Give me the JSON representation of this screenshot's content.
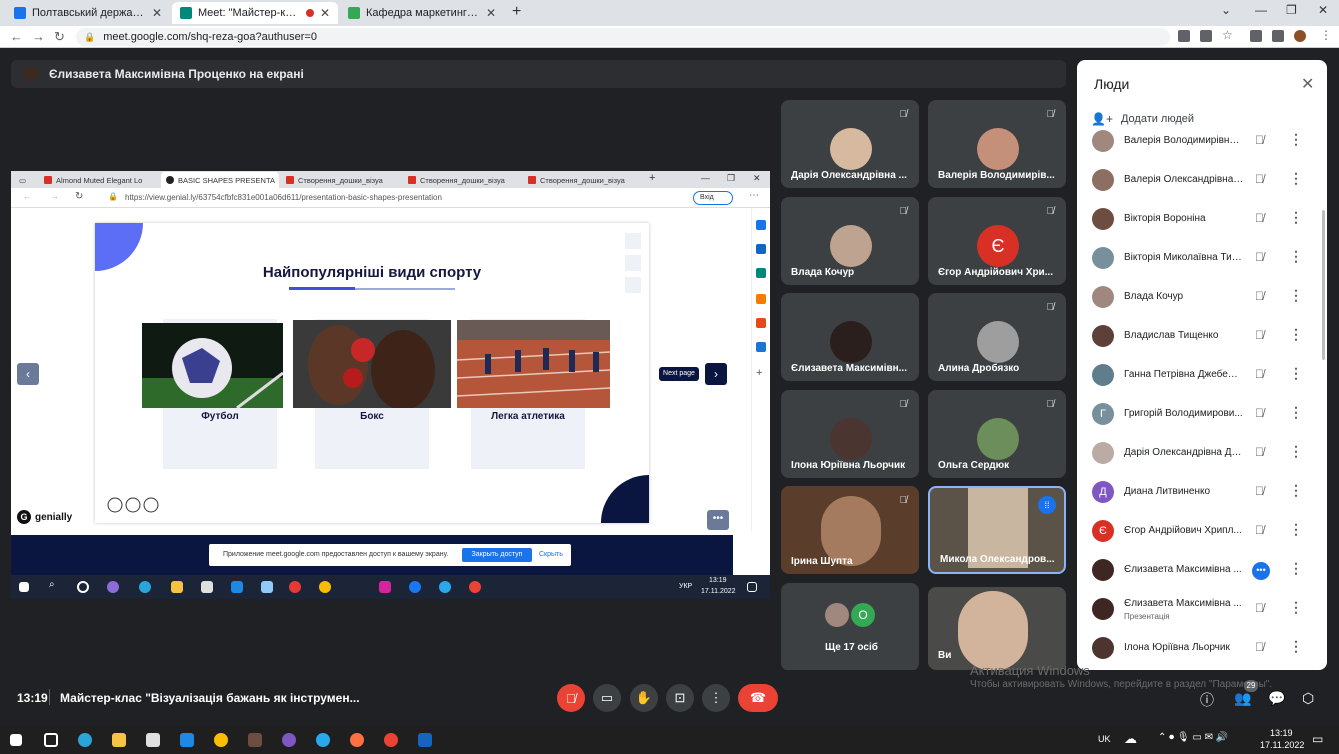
{
  "browser": {
    "tabs": [
      {
        "title": "Полтавський державний аграр",
        "color": "#1a73e8"
      },
      {
        "title": "Meet: \"Майстер-клас \"Візуа",
        "color": "#00897b"
      },
      {
        "title": "Кафедра маркетингу | Полтавс",
        "color": "#34a853"
      }
    ],
    "url": "meet.google.com/shq-reza-goa?authuser=0"
  },
  "presenter_bar": {
    "text": "Єлизавета Максимівна Проценко на екрані"
  },
  "shared_screen": {
    "tabs": [
      "Almond Muted Elegant Lo",
      "BASIC SHAPES PRESENTA",
      "Створення_дошки_візуа",
      "Створення_дошки_візуа",
      "Створення_дошки_візуа"
    ],
    "url": "https://view.genial.ly/63754cfbfc831e001a06d611/presentation-basic-shapes-presentation",
    "login_label": "Вхід",
    "slide": {
      "title": "Найпопулярніші  види спорту",
      "cards": [
        {
          "label": "Футбол"
        },
        {
          "label": "Бокс"
        },
        {
          "label": "Легка атлетика"
        }
      ]
    },
    "next_page_tooltip": "Next page",
    "brand": "genially",
    "banner_text": "Приложение meet.google.com предоставлен доступ к вашему экрану.",
    "banner_stop": "Закрыть доступ",
    "banner_hide": "Скрыть",
    "taskbar_lang": "УКР",
    "taskbar_time": "13:19",
    "taskbar_date": "17.11.2022"
  },
  "tiles": [
    {
      "name": "Дарія Олександрівна ...",
      "muted": true
    },
    {
      "name": "Валерія Володимирів...",
      "muted": true
    },
    {
      "name": "Влада Кочур",
      "muted": true
    },
    {
      "name": "Єгор Андрійович Хри...",
      "muted": true,
      "initial": "Є",
      "color": "#d93025"
    },
    {
      "name": "Єлизавета Максимівн...",
      "muted": false
    },
    {
      "name": "Алина Дробязко",
      "muted": true
    },
    {
      "name": "Ілона Юріївна Льорчик",
      "muted": true
    },
    {
      "name": "Ольга Сердюк",
      "muted": true
    },
    {
      "name": "Ірина Шупта",
      "muted": true
    },
    {
      "name": "Микола Олександров...",
      "muted": false
    },
    {
      "name": "Ще 17 осіб",
      "initial": "О",
      "color": "#34a853"
    },
    {
      "name": "Ви",
      "muted": false
    }
  ],
  "people_panel": {
    "title": "Люди",
    "add_label": "Додати людей",
    "participants": [
      {
        "name": "Валерія Володимирівна ...",
        "color": "#a1887f"
      },
      {
        "name": "Валерія Олександрівна ...",
        "color": "#8d6e63"
      },
      {
        "name": "Вікторія Вороніна",
        "color": "#6d4c41"
      },
      {
        "name": "Вікторія Миколаївна Тим...",
        "color": "#78909c"
      },
      {
        "name": "Влада Кочур",
        "color": "#a1887f"
      },
      {
        "name": "Владислав Тищенко",
        "color": "#5d4037"
      },
      {
        "name": "Ганна Петрівна Джебеже...",
        "color": "#607d8b"
      },
      {
        "name": "Григорій Володимирови...",
        "initial": "Г",
        "color": "#78909c"
      },
      {
        "name": "Дарія Олександрівна Да...",
        "color": "#bcaaa4"
      },
      {
        "name": "Диана Литвиненко",
        "initial": "Д",
        "color": "#7e57c2"
      },
      {
        "name": "Єгор Андрійович Хрипл...",
        "initial": "Є",
        "color": "#d93025"
      },
      {
        "name": "Єлизавета Максимівна ...",
        "color": "#3e2723"
      },
      {
        "name": "Єлизавета Максимівна ...",
        "sub": "Презентація",
        "color": "#3e2723"
      },
      {
        "name": "Ілона Юріївна Льорчик",
        "color": "#4e342e"
      }
    ]
  },
  "meeting": {
    "time": "13:19",
    "title": "Майстер-клас \"Візуалізація бажань як інструмен...",
    "people_count": "29"
  },
  "activation": {
    "title": "Активация Windows",
    "subtitle": "Чтобы активировать Windows, перейдите в раздел \"Параметры\"."
  },
  "windows_taskbar": {
    "lang": "UK",
    "time": "13:19",
    "date": "17.11.2022"
  }
}
